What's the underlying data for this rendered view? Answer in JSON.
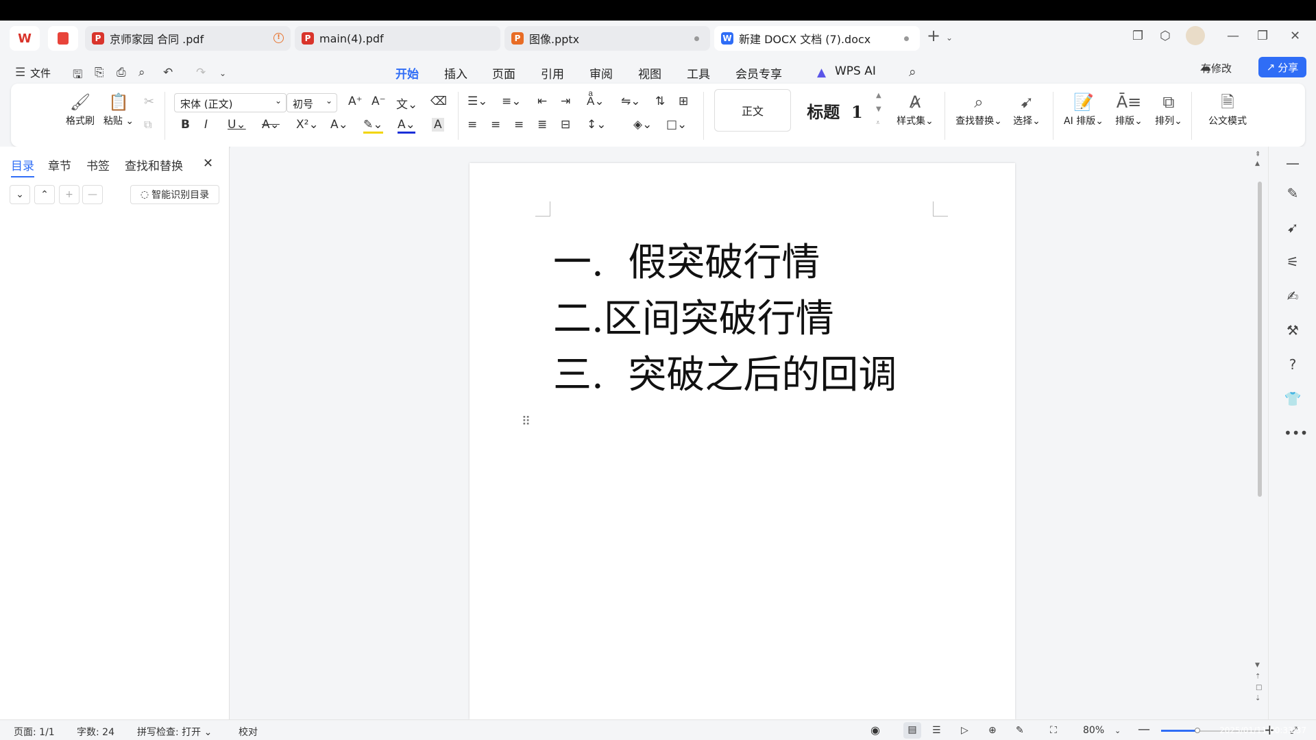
{
  "tabs": [
    {
      "label": "京师家园 合同 .pdf",
      "type": "pdf",
      "color": "#d9342b",
      "state": "warning"
    },
    {
      "label": "main(4).pdf",
      "type": "pdf",
      "color": "#d9342b"
    },
    {
      "label": "图像.pptx",
      "type": "pptx",
      "color": "#e86c25",
      "state": "modified"
    },
    {
      "label": "新建 DOCX 文档 (7).docx",
      "type": "docx",
      "color": "#2f6df6",
      "state": "modified",
      "active": true
    }
  ],
  "menu": {
    "file": "文件",
    "items": [
      "开始",
      "插入",
      "页面",
      "引用",
      "审阅",
      "视图",
      "工具",
      "会员专享"
    ],
    "active": "开始",
    "wps_ai": "WPS AI",
    "edit_state": "有修改",
    "share": "分享"
  },
  "ribbon": {
    "format_painter": "格式刷",
    "paste": "粘贴",
    "font_name": "宋体 (正文)",
    "font_size": "初号",
    "style_normal": "正文",
    "style_heading": "标题  1",
    "style_set": "样式集",
    "find_replace": "查找替换",
    "select": "选择",
    "ai_layout": "AI 排版",
    "layout": "排版",
    "arrange": "排列",
    "official_mode": "公文模式"
  },
  "left_panel": {
    "tabs": [
      "目录",
      "章节",
      "书签",
      "查找和替换"
    ],
    "active": "目录",
    "smart_toc": "智能识别目录"
  },
  "document": {
    "lines": [
      "一.  假突破行情",
      "二.区间突破行情",
      "三.  突破之后的回调"
    ]
  },
  "status": {
    "page": "页面: 1/1",
    "word_count": "字数: 24",
    "spellcheck": "拼写检查: 打开",
    "proofread": "校对",
    "zoom": "80%"
  },
  "clock": "2025/01/11 00:33:37",
  "colors": {
    "accent": "#2f6df6",
    "pdf": "#d9342b",
    "pptx": "#e86c25"
  }
}
